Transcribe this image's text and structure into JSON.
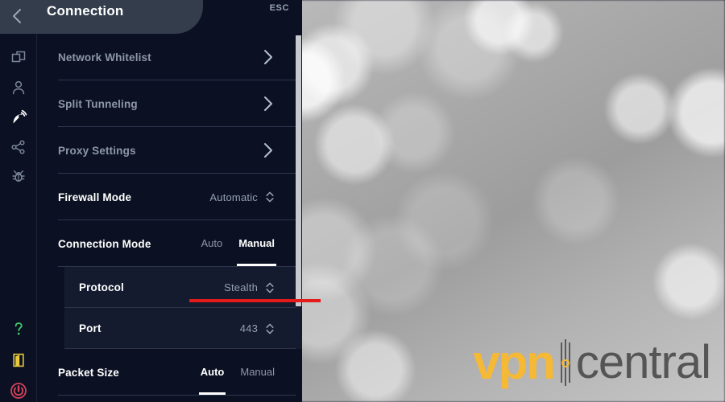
{
  "header": {
    "back_icon": "chevron-left-icon",
    "title": "Connection",
    "esc_label": "ESC"
  },
  "rail": {
    "items": [
      {
        "name": "layers-icon",
        "active": false
      },
      {
        "name": "user-icon",
        "active": false
      },
      {
        "name": "satellite-dish-icon",
        "active": true
      },
      {
        "name": "share-nodes-icon",
        "active": false
      },
      {
        "name": "bug-icon",
        "active": false
      }
    ],
    "bottom_items": [
      {
        "name": "help-question-icon",
        "color": "#3ccf6f"
      },
      {
        "name": "door-exit-icon",
        "color": "#e8c83c"
      },
      {
        "name": "power-icon",
        "color": "#d4425a"
      }
    ]
  },
  "settings": {
    "rows": [
      {
        "label": "Network Whitelist",
        "type": "link",
        "value": "",
        "muted": true
      },
      {
        "label": "Split Tunneling",
        "type": "link",
        "value": "",
        "muted": true
      },
      {
        "label": "Proxy Settings",
        "type": "link",
        "value": "",
        "muted": true
      },
      {
        "label": "Firewall Mode",
        "type": "stepper",
        "value": "Automatic",
        "muted": false
      },
      {
        "label": "Connection Mode",
        "type": "segment",
        "options": [
          "Auto",
          "Manual"
        ],
        "selected": "Manual",
        "muted": false
      }
    ],
    "subgroup": [
      {
        "label": "Protocol",
        "type": "stepper",
        "value": "Stealth"
      },
      {
        "label": "Port",
        "type": "stepper",
        "value": "443"
      }
    ],
    "trailing_rows": [
      {
        "label": "Packet Size",
        "type": "segment",
        "options": [
          "Auto",
          "Manual"
        ],
        "selected": "Auto",
        "muted": false
      }
    ]
  },
  "annotation": {
    "name": "red-underline-annotation",
    "color": "#e31b1b"
  },
  "watermark": {
    "brand_primary": "vpn",
    "brand_secondary": "central",
    "primary_color": "#f5b935",
    "secondary_color": "#555555"
  },
  "colors": {
    "panel_bg": "#0b1122",
    "titlebar_slab": "#333d4b",
    "divider": "#2d3750",
    "subgroup_bg": "#141b2e",
    "accent_text": "#ffffff",
    "muted_text": "#8d97a8"
  }
}
